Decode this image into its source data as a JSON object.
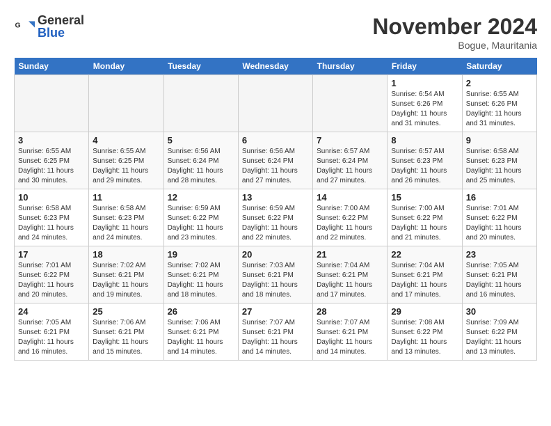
{
  "header": {
    "logo_general": "General",
    "logo_blue": "Blue",
    "month_title": "November 2024",
    "location": "Bogue, Mauritania"
  },
  "weekdays": [
    "Sunday",
    "Monday",
    "Tuesday",
    "Wednesday",
    "Thursday",
    "Friday",
    "Saturday"
  ],
  "weeks": [
    [
      {
        "day": "",
        "info": ""
      },
      {
        "day": "",
        "info": ""
      },
      {
        "day": "",
        "info": ""
      },
      {
        "day": "",
        "info": ""
      },
      {
        "day": "",
        "info": ""
      },
      {
        "day": "1",
        "info": "Sunrise: 6:54 AM\nSunset: 6:26 PM\nDaylight: 11 hours and 31 minutes."
      },
      {
        "day": "2",
        "info": "Sunrise: 6:55 AM\nSunset: 6:26 PM\nDaylight: 11 hours and 31 minutes."
      }
    ],
    [
      {
        "day": "3",
        "info": "Sunrise: 6:55 AM\nSunset: 6:25 PM\nDaylight: 11 hours and 30 minutes."
      },
      {
        "day": "4",
        "info": "Sunrise: 6:55 AM\nSunset: 6:25 PM\nDaylight: 11 hours and 29 minutes."
      },
      {
        "day": "5",
        "info": "Sunrise: 6:56 AM\nSunset: 6:24 PM\nDaylight: 11 hours and 28 minutes."
      },
      {
        "day": "6",
        "info": "Sunrise: 6:56 AM\nSunset: 6:24 PM\nDaylight: 11 hours and 27 minutes."
      },
      {
        "day": "7",
        "info": "Sunrise: 6:57 AM\nSunset: 6:24 PM\nDaylight: 11 hours and 27 minutes."
      },
      {
        "day": "8",
        "info": "Sunrise: 6:57 AM\nSunset: 6:23 PM\nDaylight: 11 hours and 26 minutes."
      },
      {
        "day": "9",
        "info": "Sunrise: 6:58 AM\nSunset: 6:23 PM\nDaylight: 11 hours and 25 minutes."
      }
    ],
    [
      {
        "day": "10",
        "info": "Sunrise: 6:58 AM\nSunset: 6:23 PM\nDaylight: 11 hours and 24 minutes."
      },
      {
        "day": "11",
        "info": "Sunrise: 6:58 AM\nSunset: 6:23 PM\nDaylight: 11 hours and 24 minutes."
      },
      {
        "day": "12",
        "info": "Sunrise: 6:59 AM\nSunset: 6:22 PM\nDaylight: 11 hours and 23 minutes."
      },
      {
        "day": "13",
        "info": "Sunrise: 6:59 AM\nSunset: 6:22 PM\nDaylight: 11 hours and 22 minutes."
      },
      {
        "day": "14",
        "info": "Sunrise: 7:00 AM\nSunset: 6:22 PM\nDaylight: 11 hours and 22 minutes."
      },
      {
        "day": "15",
        "info": "Sunrise: 7:00 AM\nSunset: 6:22 PM\nDaylight: 11 hours and 21 minutes."
      },
      {
        "day": "16",
        "info": "Sunrise: 7:01 AM\nSunset: 6:22 PM\nDaylight: 11 hours and 20 minutes."
      }
    ],
    [
      {
        "day": "17",
        "info": "Sunrise: 7:01 AM\nSunset: 6:22 PM\nDaylight: 11 hours and 20 minutes."
      },
      {
        "day": "18",
        "info": "Sunrise: 7:02 AM\nSunset: 6:21 PM\nDaylight: 11 hours and 19 minutes."
      },
      {
        "day": "19",
        "info": "Sunrise: 7:02 AM\nSunset: 6:21 PM\nDaylight: 11 hours and 18 minutes."
      },
      {
        "day": "20",
        "info": "Sunrise: 7:03 AM\nSunset: 6:21 PM\nDaylight: 11 hours and 18 minutes."
      },
      {
        "day": "21",
        "info": "Sunrise: 7:04 AM\nSunset: 6:21 PM\nDaylight: 11 hours and 17 minutes."
      },
      {
        "day": "22",
        "info": "Sunrise: 7:04 AM\nSunset: 6:21 PM\nDaylight: 11 hours and 17 minutes."
      },
      {
        "day": "23",
        "info": "Sunrise: 7:05 AM\nSunset: 6:21 PM\nDaylight: 11 hours and 16 minutes."
      }
    ],
    [
      {
        "day": "24",
        "info": "Sunrise: 7:05 AM\nSunset: 6:21 PM\nDaylight: 11 hours and 16 minutes."
      },
      {
        "day": "25",
        "info": "Sunrise: 7:06 AM\nSunset: 6:21 PM\nDaylight: 11 hours and 15 minutes."
      },
      {
        "day": "26",
        "info": "Sunrise: 7:06 AM\nSunset: 6:21 PM\nDaylight: 11 hours and 14 minutes."
      },
      {
        "day": "27",
        "info": "Sunrise: 7:07 AM\nSunset: 6:21 PM\nDaylight: 11 hours and 14 minutes."
      },
      {
        "day": "28",
        "info": "Sunrise: 7:07 AM\nSunset: 6:21 PM\nDaylight: 11 hours and 14 minutes."
      },
      {
        "day": "29",
        "info": "Sunrise: 7:08 AM\nSunset: 6:22 PM\nDaylight: 11 hours and 13 minutes."
      },
      {
        "day": "30",
        "info": "Sunrise: 7:09 AM\nSunset: 6:22 PM\nDaylight: 11 hours and 13 minutes."
      }
    ]
  ]
}
